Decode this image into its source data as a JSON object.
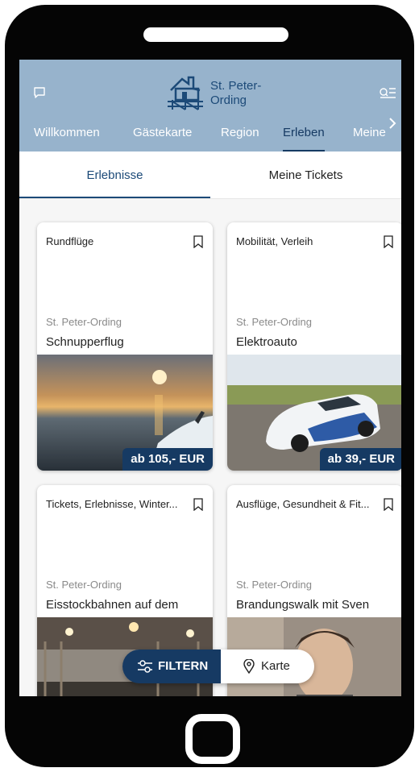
{
  "header": {
    "logo_text": "St. Peter-Ording",
    "nav_items": [
      "Willkommen",
      "Gästekarte",
      "Region",
      "Erleben",
      "Meine"
    ],
    "active_nav": "Erleben"
  },
  "subtabs": [
    "Erlebnisse",
    "Meine Tickets"
  ],
  "cards": [
    {
      "category": "Rundflüge",
      "location": "St. Peter-Ording",
      "title": "Schnupperflug",
      "price": "ab 105,- EUR"
    },
    {
      "category": "Mobilität, Verleih",
      "location": "St. Peter-Ording",
      "title": "Elektroauto",
      "price": "ab 39,- EUR"
    },
    {
      "category": "Tickets, Erlebnisse, Winter...",
      "location": "St. Peter-Ording",
      "title": "Eisstockbahnen auf dem HEIMeligen..."
    },
    {
      "category": "Ausflüge, Gesundheit & Fit...",
      "location": "St. Peter-Ording",
      "title": "Brandungswalk mit Sven Hannawald"
    }
  ],
  "actions": {
    "filter_label": "FILTERN",
    "map_label": "Karte"
  },
  "colors": {
    "header_bg": "#97b3cc",
    "brand_navy": "#163a63",
    "logo_blue": "#1c4a78"
  },
  "icons": [
    "chat-icon",
    "menu-icon",
    "chevron-right-icon",
    "bookmark-icon",
    "filter-icon",
    "map-pin-icon"
  ]
}
